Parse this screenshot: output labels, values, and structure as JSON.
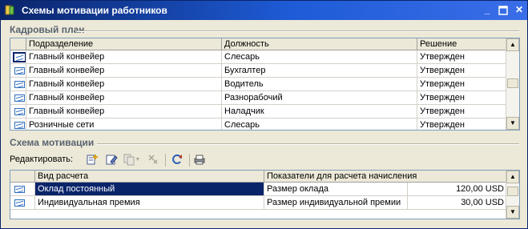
{
  "window": {
    "title": "Схемы мотивации работников"
  },
  "staff_plan": {
    "section_title": "Кадровый план",
    "columns": [
      "Подразделение",
      "Должность",
      "Решение"
    ],
    "rows": [
      {
        "department": "Главный конвейер",
        "position": "Слесарь",
        "decision": "Утвержден"
      },
      {
        "department": "Главный конвейер",
        "position": "Бухгалтер",
        "decision": "Утвержден"
      },
      {
        "department": "Главный конвейер",
        "position": "Водитель",
        "decision": "Утвержден"
      },
      {
        "department": "Главный конвейер",
        "position": "Разнорабочий",
        "decision": "Утвержден"
      },
      {
        "department": "Главный конвейер",
        "position": "Наладчик",
        "decision": "Утвержден"
      },
      {
        "department": "Розничные сети",
        "position": "Слесарь",
        "decision": "Утвержден"
      }
    ],
    "selected_row": 0
  },
  "motivation": {
    "section_title": "Схема мотивации",
    "toolbar": {
      "edit_label": "Редактировать:",
      "buttons": [
        "add-row-icon",
        "edit-row-icon",
        "copy-row-icon",
        "delete-row-icon",
        "refresh-icon",
        "print-icon"
      ]
    },
    "columns": [
      "Вид расчета",
      "Показатели для расчета начисления"
    ],
    "rows": [
      {
        "calc_type": "Оклад постоянный",
        "indicator": "Размер оклада",
        "amount": "120,00 USD"
      },
      {
        "calc_type": "Индивидуальная премия",
        "indicator": "Размер индивидуальной премии",
        "amount": "30,00 USD"
      }
    ],
    "selected_row": 0
  }
}
